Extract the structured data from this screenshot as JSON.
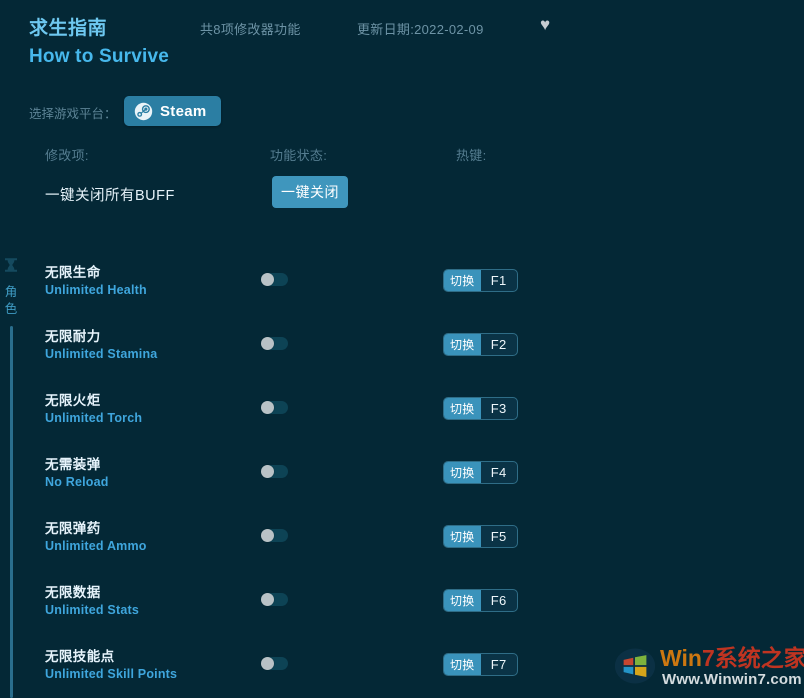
{
  "header": {
    "title_cn": "求生指南",
    "title_en": "How to Survive",
    "feature_count": "共8项修改器功能",
    "update_date": "更新日期:2022-02-09",
    "favorite_icon": "♥"
  },
  "platform": {
    "label": "选择游戏平台：",
    "selected": "Steam"
  },
  "columns": {
    "option": "修改项:",
    "status": "功能状态:",
    "hotkey": "热键:"
  },
  "onekey": {
    "label": "一键关闭所有BUFF",
    "button": "一键关闭"
  },
  "category": {
    "name": "角色",
    "icon": "character-icon"
  },
  "cheats": [
    {
      "name_cn": "无限生命",
      "name_en": "Unlimited Health",
      "enabled": false,
      "hotkey_action": "切换",
      "hotkey_key": "F1"
    },
    {
      "name_cn": "无限耐力",
      "name_en": "Unlimited Stamina",
      "enabled": false,
      "hotkey_action": "切换",
      "hotkey_key": "F2"
    },
    {
      "name_cn": "无限火炬",
      "name_en": "Unlimited Torch",
      "enabled": false,
      "hotkey_action": "切换",
      "hotkey_key": "F3"
    },
    {
      "name_cn": "无需装弹",
      "name_en": "No Reload",
      "enabled": false,
      "hotkey_action": "切换",
      "hotkey_key": "F4"
    },
    {
      "name_cn": "无限弹药",
      "name_en": "Unlimited Ammo",
      "enabled": false,
      "hotkey_action": "切换",
      "hotkey_key": "F5"
    },
    {
      "name_cn": "无限数据",
      "name_en": "Unlimited Stats",
      "enabled": false,
      "hotkey_action": "切换",
      "hotkey_key": "F6"
    },
    {
      "name_cn": "无限技能点",
      "name_en": "Unlimited Skill Points",
      "enabled": false,
      "hotkey_action": "切换",
      "hotkey_key": "F7"
    }
  ],
  "watermark": {
    "brand_w": "W",
    "brand_in": "in",
    "brand_7": "7",
    "brand_cn": "系统之家",
    "url": "Www.Winwin7.com"
  },
  "colors": {
    "background": "#042836",
    "accent": "#3a93bb",
    "title_cn": "#6ec8f0",
    "title_en": "#47b8ec",
    "subtitle_en": "#3fa6dd",
    "muted": "#5c8395"
  }
}
